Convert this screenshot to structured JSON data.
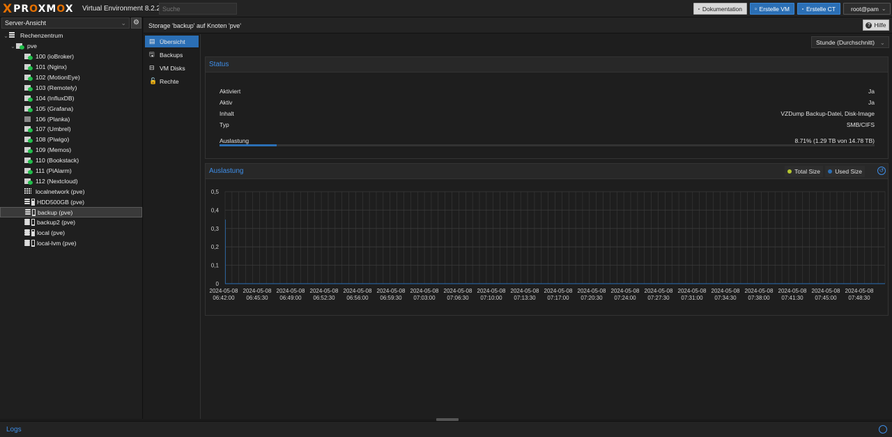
{
  "topbar": {
    "logo_x": "X",
    "logo_text_pre": "PR",
    "logo_text_o": "O",
    "logo_text_mid": "XM",
    "logo_text_o2": "O",
    "logo_text_end": "X",
    "version": "Virtual Environment 8.2.2",
    "search_placeholder": "Suche",
    "doc_label": "Dokumentation",
    "create_vm_label": "Erstelle VM",
    "create_ct_label": "Erstelle CT",
    "user_label": "root@pam"
  },
  "sidebar": {
    "view_label": "Server-Ansicht",
    "datacenter": "Rechenzentrum",
    "node": "pve",
    "guests": [
      {
        "label": "100 (ioBroker)",
        "running": true
      },
      {
        "label": "101 (Nginx)",
        "running": true
      },
      {
        "label": "102 (MotionEye)",
        "running": true
      },
      {
        "label": "103 (Remotely)",
        "running": true
      },
      {
        "label": "104 (InfluxDB)",
        "running": true
      },
      {
        "label": "105 (Grafana)",
        "running": true
      },
      {
        "label": "106 (Planka)",
        "running": false
      },
      {
        "label": "107 (Umbrel)",
        "running": true
      },
      {
        "label": "108 (Piwigo)",
        "running": true
      },
      {
        "label": "109 (Memos)",
        "running": true
      },
      {
        "label": "110 (Bookstack)",
        "running": true
      },
      {
        "label": "111 (PiAlarm)",
        "running": true
      },
      {
        "label": "112 (Nextcloud)",
        "running": true
      }
    ],
    "network": "localnetwork (pve)",
    "storages": [
      {
        "label": "HDD500GB (pve)",
        "fill": 0.8,
        "selected": false
      },
      {
        "label": "backup (pve)",
        "fill": 0.1,
        "selected": true
      },
      {
        "label": "backup2 (pve)",
        "fill": 0.1,
        "selected": false
      },
      {
        "label": "local (pve)",
        "fill": 0.7,
        "selected": false
      },
      {
        "label": "local-lvm (pve)",
        "fill": 0.1,
        "selected": false
      }
    ]
  },
  "header": {
    "title": "Storage 'backup' auf Knoten 'pve'",
    "help_label": "Hilfe"
  },
  "subnav": [
    {
      "label": "Übersicht",
      "icon": "book-icon",
      "active": true
    },
    {
      "label": "Backups",
      "icon": "floppy-icon",
      "active": false
    },
    {
      "label": "VM Disks",
      "icon": "hdd-icon",
      "active": false
    },
    {
      "label": "Rechte",
      "icon": "unlock-icon",
      "active": false
    }
  ],
  "timeframe": "Stunde (Durchschnitt)",
  "status": {
    "title": "Status",
    "rows": [
      {
        "label": "Aktiviert",
        "value": "Ja"
      },
      {
        "label": "Aktiv",
        "value": "Ja"
      },
      {
        "label": "Inhalt",
        "value": "VZDump Backup-Datei, Disk-Image"
      },
      {
        "label": "Typ",
        "value": "SMB/CIFS"
      }
    ],
    "usage_label": "Auslastung",
    "usage_value": "8.71% (1.29 TB von 14.78 TB)",
    "usage_fraction": 0.0871
  },
  "usage_panel": {
    "title": "Auslastung",
    "legend_total": "Total Size",
    "legend_used": "Used Size",
    "colors": {
      "total": "#b5c630",
      "used": "#2b6fb5"
    }
  },
  "chart_data": {
    "type": "area",
    "y_ticks": [
      "0,5",
      "0,4",
      "0,3",
      "0,2",
      "0,1",
      "0"
    ],
    "ylim": [
      0,
      0.5
    ],
    "x_labels": [
      [
        "2024-05-08",
        "06:42:00"
      ],
      [
        "2024-05-08",
        "06:45:30"
      ],
      [
        "2024-05-08",
        "06:49:00"
      ],
      [
        "2024-05-08",
        "06:52:30"
      ],
      [
        "2024-05-08",
        "06:56:00"
      ],
      [
        "2024-05-08",
        "06:59:30"
      ],
      [
        "2024-05-08",
        "07:03:00"
      ],
      [
        "2024-05-08",
        "07:06:30"
      ],
      [
        "2024-05-08",
        "07:10:00"
      ],
      [
        "2024-05-08",
        "07:13:30"
      ],
      [
        "2024-05-08",
        "07:17:00"
      ],
      [
        "2024-05-08",
        "07:20:30"
      ],
      [
        "2024-05-08",
        "07:24:00"
      ],
      [
        "2024-05-08",
        "07:27:30"
      ],
      [
        "2024-05-08",
        "07:31:00"
      ],
      [
        "2024-05-08",
        "07:34:30"
      ],
      [
        "2024-05-08",
        "07:38:00"
      ],
      [
        "2024-05-08",
        "07:41:30"
      ],
      [
        "2024-05-08",
        "07:45:00"
      ],
      [
        "2024-05-08",
        "07:48:30"
      ]
    ],
    "series": [
      {
        "name": "Total Size",
        "values": []
      },
      {
        "name": "Used Size",
        "values": []
      }
    ],
    "grid": true
  },
  "logs": {
    "title": "Logs"
  }
}
